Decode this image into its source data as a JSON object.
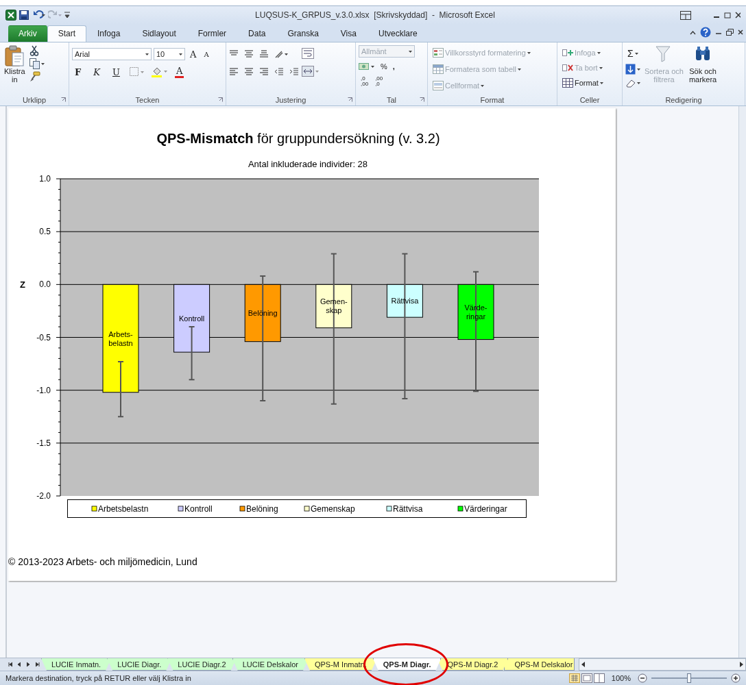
{
  "title_bar": {
    "title": "LUQSUS-K_GRPUS_v.3.0.xlsx  [Skrivskyddad]  -  Microsoft Excel"
  },
  "ribbon_tabs": [
    {
      "label": "Arkiv",
      "kind": "file",
      "selected": false
    },
    {
      "label": "Start",
      "kind": "tab",
      "selected": true
    },
    {
      "label": "Infoga",
      "kind": "tab",
      "selected": false
    },
    {
      "label": "Sidlayout",
      "kind": "tab",
      "selected": false
    },
    {
      "label": "Formler",
      "kind": "tab",
      "selected": false
    },
    {
      "label": "Data",
      "kind": "tab",
      "selected": false
    },
    {
      "label": "Granska",
      "kind": "tab",
      "selected": false
    },
    {
      "label": "Visa",
      "kind": "tab",
      "selected": false
    },
    {
      "label": "Utvecklare",
      "kind": "tab",
      "selected": false
    }
  ],
  "ribbon": {
    "clipboard": {
      "label": "Urklipp",
      "paste": [
        "Klistra",
        "in"
      ]
    },
    "font": {
      "label": "Tecken",
      "font_name": "Arial",
      "font_size": "10",
      "grow": "A",
      "shrink": "A",
      "bold": "F",
      "italic": "K",
      "underline": "U",
      "font_color": "A"
    },
    "alignment": {
      "label": "Justering"
    },
    "number": {
      "label": "Tal",
      "format": {
        "value": "Allmänt",
        "disabled": true
      },
      "percent": "%",
      "comma": ",",
      "increase_decimals": [
        ",0",
        ",00"
      ],
      "decrease_decimals": [
        ",00",
        ",0"
      ]
    },
    "styles": {
      "label": "Format",
      "items": [
        {
          "label": "Villkorsstyrd formatering",
          "disabled": true
        },
        {
          "label": "Formatera som tabell",
          "disabled": true
        },
        {
          "label": "Cellformat",
          "disabled": true
        }
      ]
    },
    "cells": {
      "label": "Celler",
      "items": [
        {
          "label": "Infoga",
          "disabled": true
        },
        {
          "label": "Ta bort",
          "disabled": true
        },
        {
          "label": "Format",
          "disabled": false
        }
      ]
    },
    "editing": {
      "label": "Redigering",
      "sum": "Σ",
      "sort": {
        "lines": [
          "Sortera och",
          "filtrera"
        ],
        "disabled": true
      },
      "find": {
        "lines": [
          "Sök och",
          "markera"
        ],
        "disabled": false
      }
    }
  },
  "chart": {
    "title": "**QPS-Mismatch** för gruppundersökning (v. 3.2)",
    "subtitle": "Antal inkluderade individer:  28",
    "chart_data": {
      "type": "bar",
      "ylabel": "Z",
      "categories": [
        "Arbetsbelastn",
        "Kontroll",
        "Belöning",
        "Gemenskap",
        "Rättvisa",
        "Värderingar"
      ],
      "series": [
        {
          "values": [
            -1.02,
            -0.64,
            -0.54,
            -0.41,
            -0.31,
            -0.52
          ],
          "errors": [
            [
              -1.25,
              -0.73
            ],
            [
              -0.9,
              -0.4
            ],
            [
              -1.1,
              0.08
            ],
            [
              -1.13,
              0.29
            ],
            [
              -1.08,
              0.29
            ],
            [
              -1.01,
              0.12
            ]
          ]
        }
      ],
      "ylim": [
        -2,
        1
      ],
      "yticks": [
        {
          "value": 1,
          "label": "1.0"
        },
        {
          "value": 0.5,
          "label": "0.5"
        },
        {
          "value": 0,
          "label": "0.0"
        },
        {
          "value": -0.5,
          "label": "-0.5"
        },
        {
          "value": -1,
          "label": "-1.0"
        },
        {
          "value": -1.5,
          "label": "-1.5"
        },
        {
          "value": -2,
          "label": "-2.0"
        }
      ],
      "grid": true,
      "value_labels": [
        "Arbets- belastn",
        "Kontroll",
        "Belöning",
        "Gemen- skap",
        "Rättvisa",
        "Värde- ringar"
      ]
    },
    "bars": [
      {
        "color": "#ffff00"
      },
      {
        "color": "#ccccff"
      },
      {
        "color": "#ff9900"
      },
      {
        "color": "#ffffcc"
      },
      {
        "color": "#ccffff"
      },
      {
        "color": "#00ff00"
      }
    ],
    "copyright": "© 2013-2023 Arbets- och miljömedicin, Lund"
  },
  "sheet_tabs": [
    {
      "label": "LUCIE Inmatn.",
      "color": "#ccffcc",
      "selected": false,
      "circled": false
    },
    {
      "label": "LUCIE Diagr.",
      "color": "#ccffcc",
      "selected": false,
      "circled": false
    },
    {
      "label": "LUCIE Diagr.2",
      "color": "#ccffcc",
      "selected": false,
      "circled": false
    },
    {
      "label": "LUCIE Delskalor",
      "color": "#ccffcc",
      "selected": false,
      "circled": false
    },
    {
      "label": "QPS-M Inmatn.",
      "color": "#ffff99",
      "selected": false,
      "circled": false
    },
    {
      "label": "QPS-M Diagr.",
      "selected": true,
      "circled": true
    },
    {
      "label": "QPS-M Diagr.2",
      "color": "#ffff99",
      "selected": false,
      "circled": false
    },
    {
      "label": "QPS-M Delskalor",
      "color": "#ffff99",
      "selected": false,
      "circled": false
    }
  ],
  "status_bar": {
    "message": "Markera destination, tryck på RETUR eller välj Klistra in",
    "zoom": "100%",
    "zoom_slider": {
      "level": 0.5
    }
  }
}
